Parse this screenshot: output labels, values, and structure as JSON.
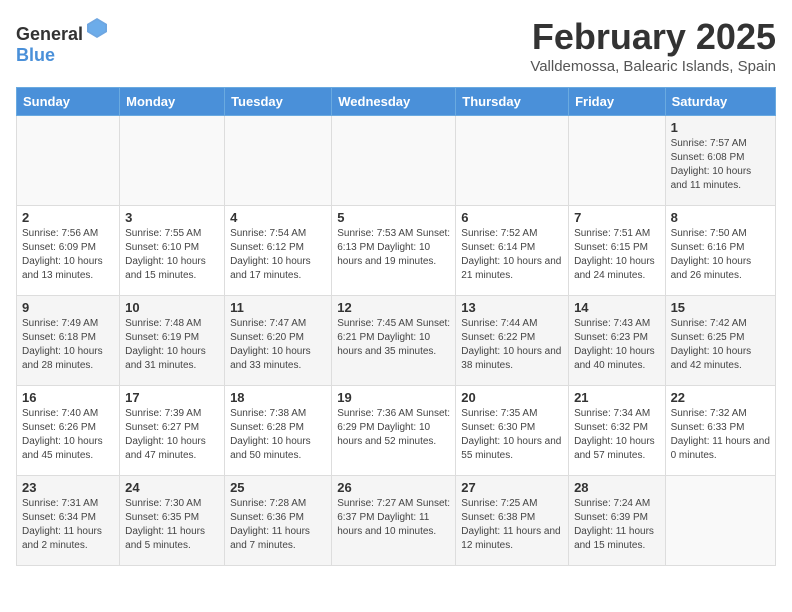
{
  "header": {
    "logo_general": "General",
    "logo_blue": "Blue",
    "month_year": "February 2025",
    "location": "Valldemossa, Balearic Islands, Spain"
  },
  "weekdays": [
    "Sunday",
    "Monday",
    "Tuesday",
    "Wednesday",
    "Thursday",
    "Friday",
    "Saturday"
  ],
  "weeks": [
    [
      {
        "day": "",
        "info": ""
      },
      {
        "day": "",
        "info": ""
      },
      {
        "day": "",
        "info": ""
      },
      {
        "day": "",
        "info": ""
      },
      {
        "day": "",
        "info": ""
      },
      {
        "day": "",
        "info": ""
      },
      {
        "day": "1",
        "info": "Sunrise: 7:57 AM\nSunset: 6:08 PM\nDaylight: 10 hours\nand 11 minutes."
      }
    ],
    [
      {
        "day": "2",
        "info": "Sunrise: 7:56 AM\nSunset: 6:09 PM\nDaylight: 10 hours\nand 13 minutes."
      },
      {
        "day": "3",
        "info": "Sunrise: 7:55 AM\nSunset: 6:10 PM\nDaylight: 10 hours\nand 15 minutes."
      },
      {
        "day": "4",
        "info": "Sunrise: 7:54 AM\nSunset: 6:12 PM\nDaylight: 10 hours\nand 17 minutes."
      },
      {
        "day": "5",
        "info": "Sunrise: 7:53 AM\nSunset: 6:13 PM\nDaylight: 10 hours\nand 19 minutes."
      },
      {
        "day": "6",
        "info": "Sunrise: 7:52 AM\nSunset: 6:14 PM\nDaylight: 10 hours\nand 21 minutes."
      },
      {
        "day": "7",
        "info": "Sunrise: 7:51 AM\nSunset: 6:15 PM\nDaylight: 10 hours\nand 24 minutes."
      },
      {
        "day": "8",
        "info": "Sunrise: 7:50 AM\nSunset: 6:16 PM\nDaylight: 10 hours\nand 26 minutes."
      }
    ],
    [
      {
        "day": "9",
        "info": "Sunrise: 7:49 AM\nSunset: 6:18 PM\nDaylight: 10 hours\nand 28 minutes."
      },
      {
        "day": "10",
        "info": "Sunrise: 7:48 AM\nSunset: 6:19 PM\nDaylight: 10 hours\nand 31 minutes."
      },
      {
        "day": "11",
        "info": "Sunrise: 7:47 AM\nSunset: 6:20 PM\nDaylight: 10 hours\nand 33 minutes."
      },
      {
        "day": "12",
        "info": "Sunrise: 7:45 AM\nSunset: 6:21 PM\nDaylight: 10 hours\nand 35 minutes."
      },
      {
        "day": "13",
        "info": "Sunrise: 7:44 AM\nSunset: 6:22 PM\nDaylight: 10 hours\nand 38 minutes."
      },
      {
        "day": "14",
        "info": "Sunrise: 7:43 AM\nSunset: 6:23 PM\nDaylight: 10 hours\nand 40 minutes."
      },
      {
        "day": "15",
        "info": "Sunrise: 7:42 AM\nSunset: 6:25 PM\nDaylight: 10 hours\nand 42 minutes."
      }
    ],
    [
      {
        "day": "16",
        "info": "Sunrise: 7:40 AM\nSunset: 6:26 PM\nDaylight: 10 hours\nand 45 minutes."
      },
      {
        "day": "17",
        "info": "Sunrise: 7:39 AM\nSunset: 6:27 PM\nDaylight: 10 hours\nand 47 minutes."
      },
      {
        "day": "18",
        "info": "Sunrise: 7:38 AM\nSunset: 6:28 PM\nDaylight: 10 hours\nand 50 minutes."
      },
      {
        "day": "19",
        "info": "Sunrise: 7:36 AM\nSunset: 6:29 PM\nDaylight: 10 hours\nand 52 minutes."
      },
      {
        "day": "20",
        "info": "Sunrise: 7:35 AM\nSunset: 6:30 PM\nDaylight: 10 hours\nand 55 minutes."
      },
      {
        "day": "21",
        "info": "Sunrise: 7:34 AM\nSunset: 6:32 PM\nDaylight: 10 hours\nand 57 minutes."
      },
      {
        "day": "22",
        "info": "Sunrise: 7:32 AM\nSunset: 6:33 PM\nDaylight: 11 hours\nand 0 minutes."
      }
    ],
    [
      {
        "day": "23",
        "info": "Sunrise: 7:31 AM\nSunset: 6:34 PM\nDaylight: 11 hours\nand 2 minutes."
      },
      {
        "day": "24",
        "info": "Sunrise: 7:30 AM\nSunset: 6:35 PM\nDaylight: 11 hours\nand 5 minutes."
      },
      {
        "day": "25",
        "info": "Sunrise: 7:28 AM\nSunset: 6:36 PM\nDaylight: 11 hours\nand 7 minutes."
      },
      {
        "day": "26",
        "info": "Sunrise: 7:27 AM\nSunset: 6:37 PM\nDaylight: 11 hours\nand 10 minutes."
      },
      {
        "day": "27",
        "info": "Sunrise: 7:25 AM\nSunset: 6:38 PM\nDaylight: 11 hours\nand 12 minutes."
      },
      {
        "day": "28",
        "info": "Sunrise: 7:24 AM\nSunset: 6:39 PM\nDaylight: 11 hours\nand 15 minutes."
      },
      {
        "day": "",
        "info": ""
      }
    ]
  ]
}
